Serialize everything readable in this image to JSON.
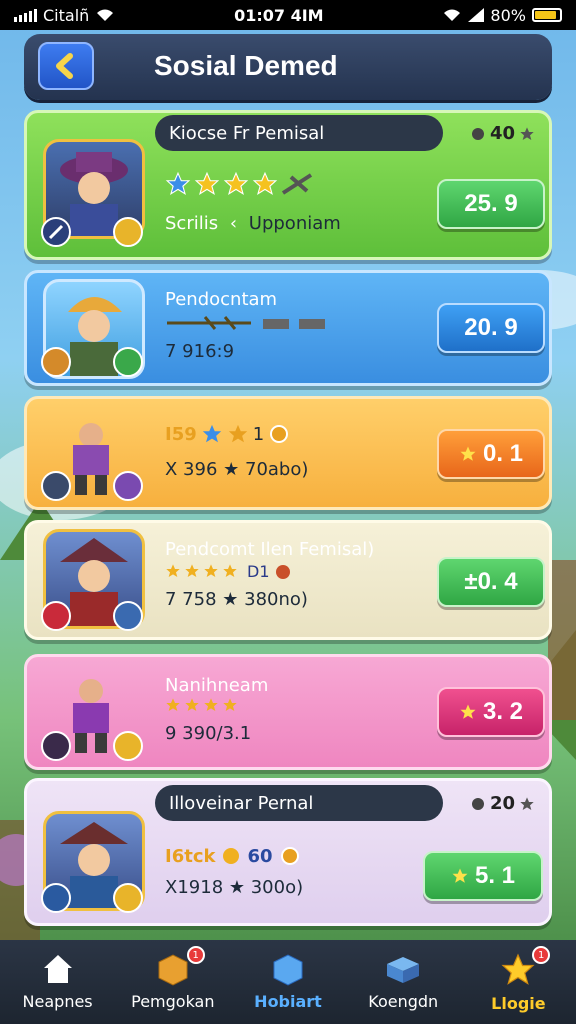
{
  "status_bar": {
    "carrier": "Citalñ",
    "time": "01:07 4IM",
    "battery": "80%"
  },
  "header": {
    "title": "Sosial Demed"
  },
  "cards": [
    {
      "rank_label": "Kiocse Fr Pemisal",
      "points": "40",
      "subtitle_a": "Scrilis",
      "subtitle_sep": "‹",
      "subtitle_b": "Upponiam",
      "score": "25. 9"
    },
    {
      "name": "Pendocntam",
      "stat": "7 916:9",
      "score": "20. 9"
    },
    {
      "name": "I59",
      "level": "1",
      "stat": "X 396 ★ 70abo)",
      "score": "0. 1"
    },
    {
      "name": "Pendcomt Ilen Femisal)",
      "stat_badge": "D1",
      "stat": "7 758 ★ 380no)",
      "score": "±0. 4"
    },
    {
      "name": "Nanihneam",
      "stat": "9 390/3.1",
      "score": "3. 2"
    },
    {
      "rank_label": "Illoveinar Pernal",
      "points": "20",
      "name": "I6tck",
      "level": "60",
      "stat": "X1918 ★ 300o)",
      "score": "5. 1"
    }
  ],
  "nav": [
    {
      "label": "Neapnes",
      "icon": "home-icon"
    },
    {
      "label": "Pemgokan",
      "icon": "crate-icon",
      "badge": "1"
    },
    {
      "label": "Hobiart",
      "icon": "cube-icon"
    },
    {
      "label": "Koengdn",
      "icon": "box-icon"
    },
    {
      "label": "Llogie",
      "icon": "star-icon",
      "badge": "1"
    }
  ]
}
